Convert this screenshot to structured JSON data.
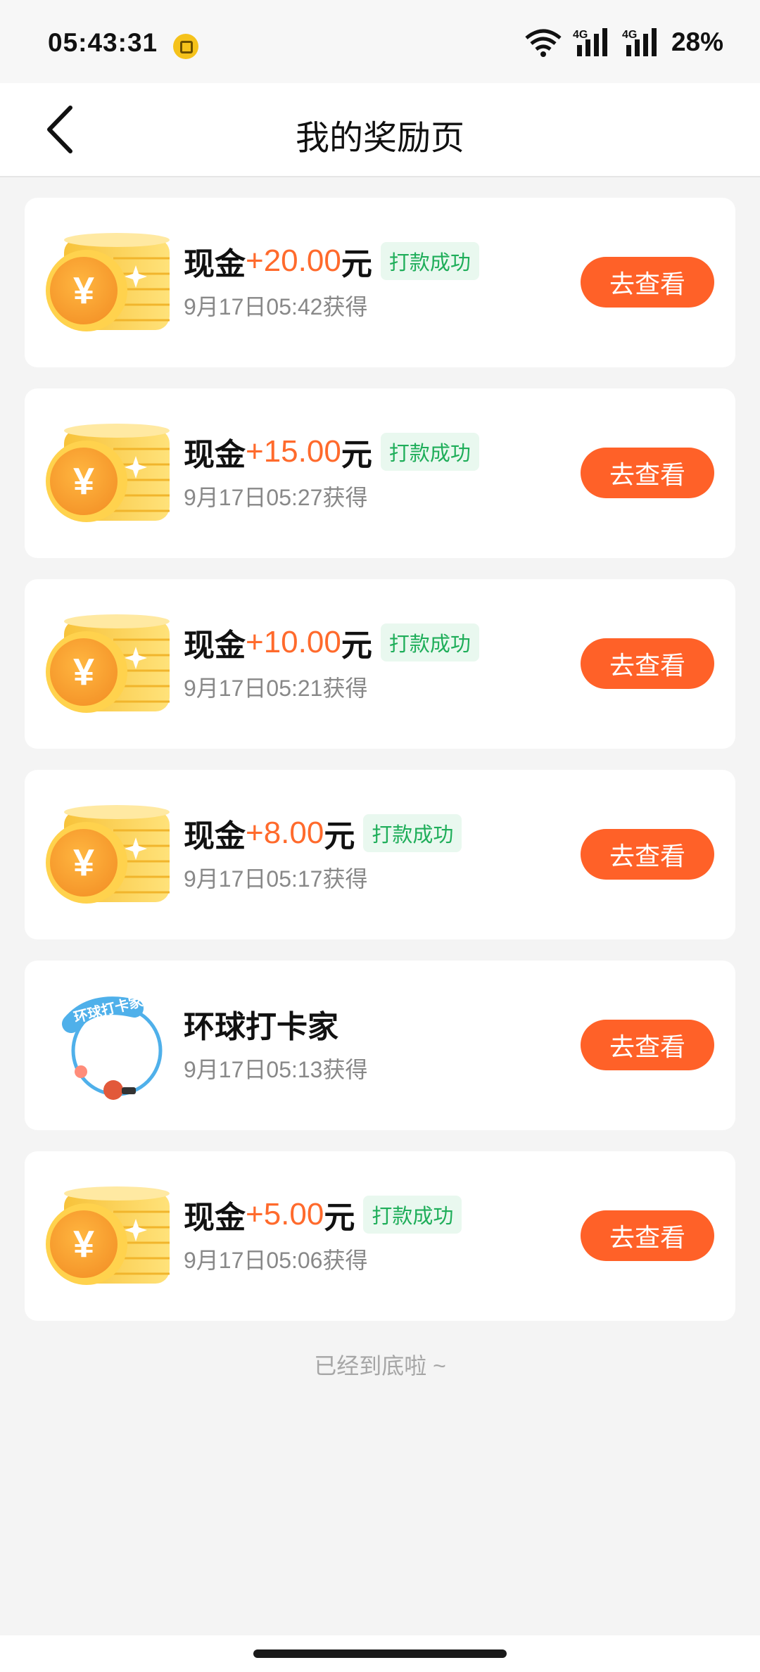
{
  "status_bar": {
    "time": "05:43:31",
    "battery": "28%",
    "network_label_1": "4G",
    "network_label_2": "4G"
  },
  "header": {
    "title": "我的奖励页",
    "back_icon": "chevron-left-icon"
  },
  "rewards": [
    {
      "type": "cash",
      "label": "现金",
      "amount": "+20.00",
      "unit": "元",
      "status": "打款成功",
      "time": "9月17日05:42获得",
      "button": "去查看"
    },
    {
      "type": "cash",
      "label": "现金",
      "amount": "+15.00",
      "unit": "元",
      "status": "打款成功",
      "time": "9月17日05:27获得",
      "button": "去查看"
    },
    {
      "type": "cash",
      "label": "现金",
      "amount": "+10.00",
      "unit": "元",
      "status": "打款成功",
      "time": "9月17日05:21获得",
      "button": "去查看"
    },
    {
      "type": "cash",
      "label": "现金",
      "amount": "+8.00",
      "unit": "元",
      "status": "打款成功",
      "time": "9月17日05:17获得",
      "button": "去查看"
    },
    {
      "type": "frame",
      "label": "环球打卡家",
      "amount": "",
      "unit": "",
      "status": "",
      "time": "9月17日05:13获得",
      "button": "去查看",
      "frame_text": "环球打卡家"
    },
    {
      "type": "cash",
      "label": "现金",
      "amount": "+5.00",
      "unit": "元",
      "status": "打款成功",
      "time": "9月17日05:06获得",
      "button": "去查看"
    }
  ],
  "footer": {
    "end_text": "已经到底啦 ~"
  },
  "colors": {
    "accent": "#ff6128",
    "amount": "#ff6a2c",
    "success": "#1fae5a"
  }
}
